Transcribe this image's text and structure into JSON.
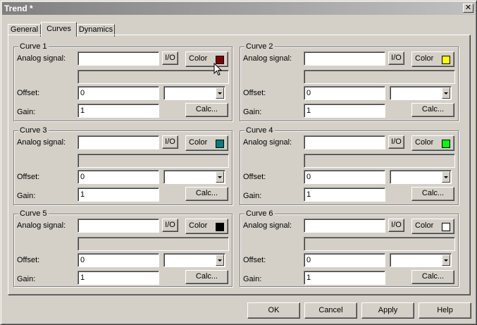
{
  "window": {
    "title": "Trend *"
  },
  "tabs": [
    {
      "label": "General"
    },
    {
      "label": "Curves"
    },
    {
      "label": "Dynamics"
    }
  ],
  "labels": {
    "analog_signal": "Analog signal:",
    "offset": "Offset:",
    "gain": "Gain:",
    "io": "I/O",
    "color": "Color",
    "calc": "Calc..."
  },
  "curves": [
    {
      "title": "Curve 1",
      "analog_signal": "",
      "offset": "0",
      "gain": "1",
      "color": "#800000"
    },
    {
      "title": "Curve 2",
      "analog_signal": "",
      "offset": "0",
      "gain": "1",
      "color": "#ffff00"
    },
    {
      "title": "Curve 3",
      "analog_signal": "",
      "offset": "0",
      "gain": "1",
      "color": "#008080"
    },
    {
      "title": "Curve 4",
      "analog_signal": "",
      "offset": "0",
      "gain": "1",
      "color": "#00ff00"
    },
    {
      "title": "Curve 5",
      "analog_signal": "",
      "offset": "0",
      "gain": "1",
      "color": "#000000"
    },
    {
      "title": "Curve 6",
      "analog_signal": "",
      "offset": "0",
      "gain": "1",
      "color": "#ffffff"
    }
  ],
  "footer": {
    "ok": "OK",
    "cancel": "Cancel",
    "apply": "Apply",
    "help": "Help"
  }
}
